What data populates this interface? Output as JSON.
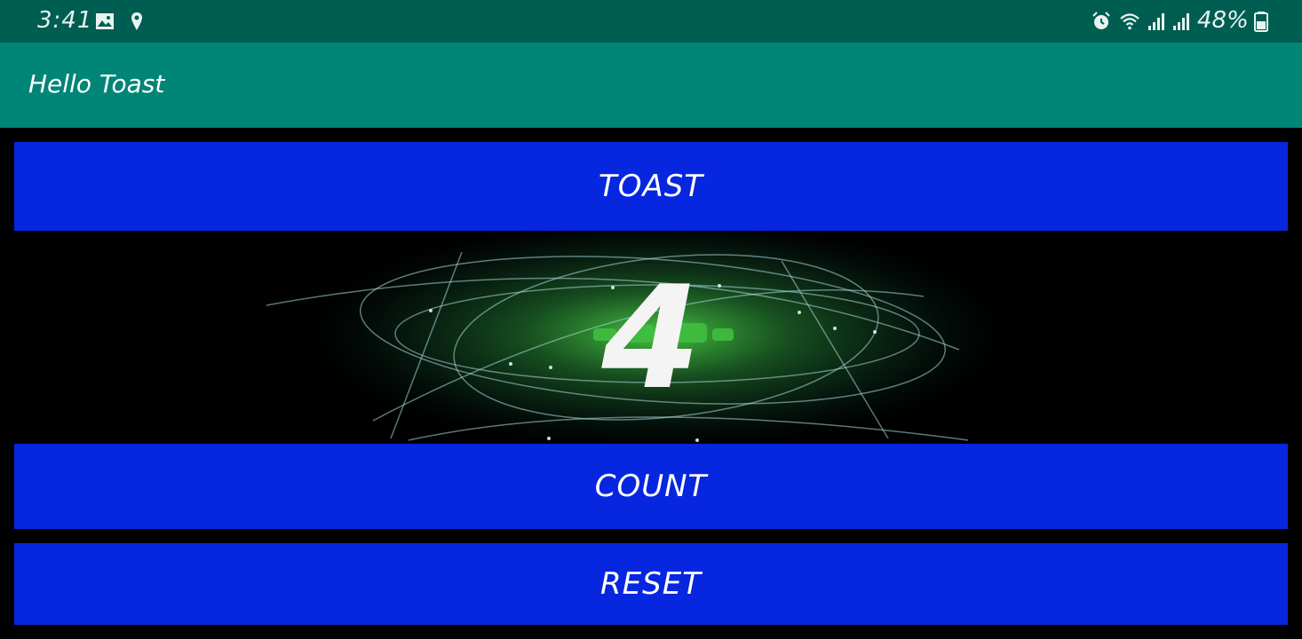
{
  "status_bar": {
    "time": "3:41",
    "battery_percent": "48%",
    "icons": [
      "image-icon",
      "location-pin-icon",
      "alarm-icon",
      "wifi-icon",
      "signal-icon",
      "signal-icon-2",
      "battery-icon"
    ]
  },
  "app_bar": {
    "title": "Hello Toast"
  },
  "buttons": {
    "toast_label": "TOAST",
    "count_label": "COUNT",
    "reset_label": "RESET"
  },
  "counter": {
    "value": "4"
  },
  "colors": {
    "status_bar": "#005d51",
    "app_bar": "#008577",
    "button": "#0726df",
    "background": "#000000"
  }
}
